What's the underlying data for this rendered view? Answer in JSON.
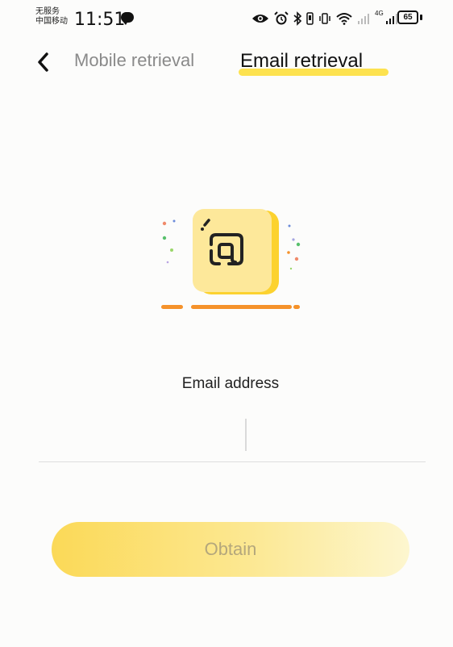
{
  "status_bar": {
    "carrier_line1": "无服务",
    "carrier_line2": "中国移动",
    "time": "11:51",
    "battery": "65",
    "network_label": "4G"
  },
  "header": {
    "tabs": [
      {
        "label": "Mobile retrieval",
        "active": false
      },
      {
        "label": "Email retrieval",
        "active": true
      }
    ]
  },
  "form": {
    "email_label": "Email address",
    "email_value": "",
    "email_placeholder": ""
  },
  "actions": {
    "obtain_label": "Obtain"
  },
  "colors": {
    "accent": "#fde24f",
    "button_start": "#fbd957",
    "button_end": "#fdf6cf",
    "illustration_orange": "#f5922a"
  },
  "icons": [
    "eye-icon",
    "alarm-icon",
    "bluetooth-icon",
    "vibrate-icon",
    "wifi-icon",
    "signal-icon",
    "battery-icon",
    "back-arrow-icon",
    "email-at-icon"
  ]
}
